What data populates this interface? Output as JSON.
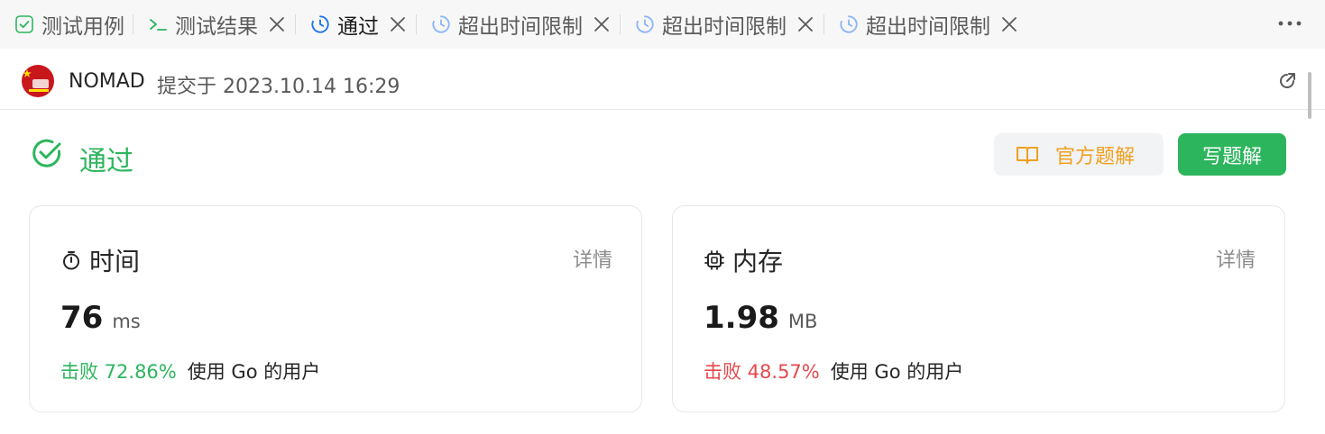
{
  "tabs": [
    {
      "label": "测试用例",
      "icon": "checkbox-icon",
      "closable": false,
      "active": false
    },
    {
      "label": "测试结果",
      "icon": "terminal-icon",
      "closable": true,
      "active": false
    },
    {
      "label": "通过",
      "icon": "clock-icon",
      "closable": true,
      "active": true
    },
    {
      "label": "超出时间限制",
      "icon": "clock-icon",
      "closable": true,
      "active": false
    },
    {
      "label": "超出时间限制",
      "icon": "clock-icon",
      "closable": true,
      "active": false
    },
    {
      "label": "超出时间限制",
      "icon": "clock-icon",
      "closable": true,
      "active": false
    }
  ],
  "submission": {
    "author": "NOMAD",
    "meta": "提交于 2023.10.14 16:29"
  },
  "status": {
    "text": "通过",
    "color": "#2db55d"
  },
  "actions": {
    "official_label": "官方题解",
    "write_label": "写题解"
  },
  "time_card": {
    "title": "时间",
    "detail": "详情",
    "value": "76",
    "unit": "ms",
    "beat_pct": "击败 72.86%",
    "beat_rest": "使用 Go 的用户",
    "beat_color": "#2db55d"
  },
  "memory_card": {
    "title": "内存",
    "detail": "详情",
    "value": "1.98",
    "unit": "MB",
    "beat_pct": "击败 48.57%",
    "beat_rest": "使用 Go 的用户",
    "beat_color": "#e5484d"
  }
}
